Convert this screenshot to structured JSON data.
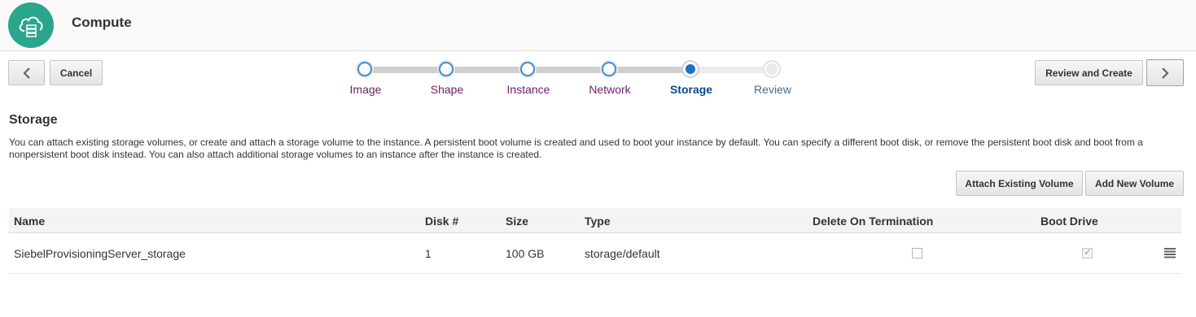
{
  "header": {
    "title": "Compute",
    "logo_icon": "cloud-server-icon",
    "logo_color": "#2aa58e"
  },
  "toolbar": {
    "back_icon": "chevron-left-icon",
    "cancel_label": "Cancel",
    "review_create_label": "Review and Create",
    "next_icon": "chevron-right-icon"
  },
  "train": {
    "steps": [
      {
        "label": "Image",
        "state": "visited"
      },
      {
        "label": "Shape",
        "state": "visited"
      },
      {
        "label": "Instance",
        "state": "visited"
      },
      {
        "label": "Network",
        "state": "visited"
      },
      {
        "label": "Storage",
        "state": "current"
      },
      {
        "label": "Review",
        "state": "unvisited"
      }
    ],
    "accent_color": "#1d72c9"
  },
  "section": {
    "title": "Storage",
    "description": "You can attach existing storage volumes, or create and attach a storage volume to the instance. A persistent boot volume is created and used to boot your instance by default. You can specify a different boot disk, or remove the persistent boot disk and boot from a nonpersistent boot disk instead. You can also attach additional storage volumes to an instance after the instance is created."
  },
  "actions": {
    "attach_existing_label": "Attach Existing Volume",
    "add_new_label": "Add New Volume"
  },
  "table": {
    "columns": [
      "Name",
      "Disk #",
      "Size",
      "Type",
      "Delete On Termination",
      "Boot Drive"
    ],
    "rows": [
      {
        "name": "SiebelProvisioningServer_storage",
        "disk": "1",
        "size": "100 GB",
        "type": "storage/default",
        "delete_on_termination": false,
        "boot_drive": true,
        "menu_icon": "hamburger-menu-icon"
      }
    ]
  }
}
